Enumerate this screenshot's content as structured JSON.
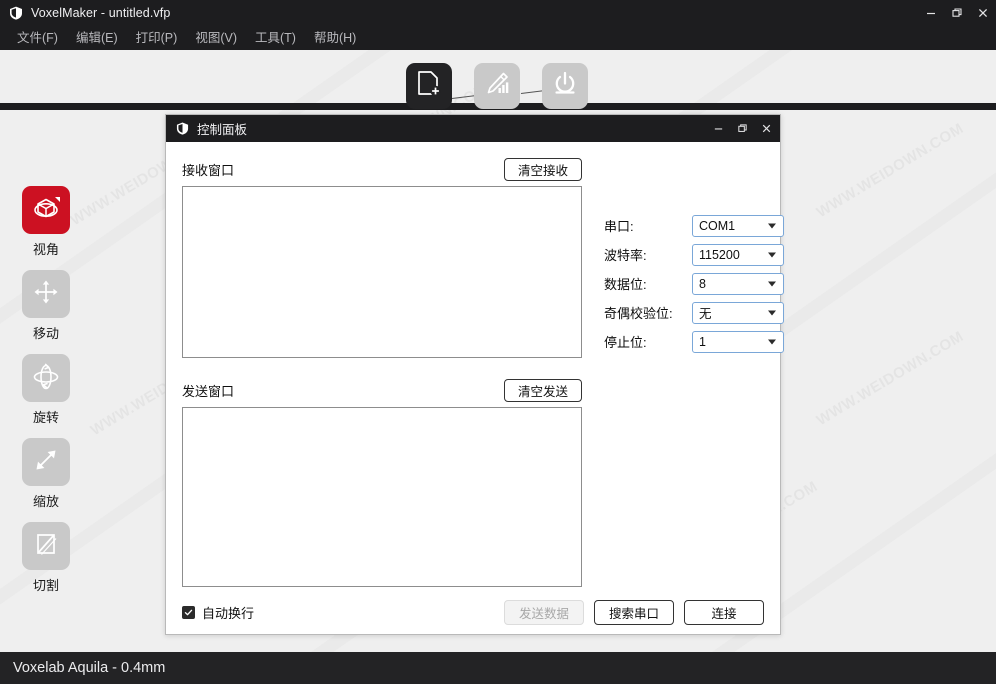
{
  "window": {
    "title": "VoxelMaker - untitled.vfp",
    "logo_icon": "voxelmaker-shield-icon",
    "controls": {
      "minimize": "minimize-icon",
      "restore": "restore-icon",
      "close": "close-icon"
    }
  },
  "menubar": {
    "items": [
      {
        "label": "文件(F)",
        "name": "menu-file"
      },
      {
        "label": "编辑(E)",
        "name": "menu-edit"
      },
      {
        "label": "打印(P)",
        "name": "menu-print"
      },
      {
        "label": "视图(V)",
        "name": "menu-view"
      },
      {
        "label": "工具(T)",
        "name": "menu-tools"
      },
      {
        "label": "帮助(H)",
        "name": "menu-help"
      }
    ]
  },
  "toolbar": {
    "buttons": [
      {
        "icon": "add-file-icon",
        "active": true
      },
      {
        "icon": "edit-chart-icon",
        "active": false
      },
      {
        "icon": "print-power-icon",
        "active": false
      }
    ]
  },
  "sidebar": {
    "items": [
      {
        "label": "视角",
        "icon": "view-cube-icon",
        "active": true
      },
      {
        "label": "移动",
        "icon": "move-arrows-icon",
        "active": false
      },
      {
        "label": "旋转",
        "icon": "rotate-icon",
        "active": false
      },
      {
        "label": "缩放",
        "icon": "scale-diagonal-arrow-icon",
        "active": false
      },
      {
        "label": "切割",
        "icon": "cut-plane-icon",
        "active": false
      }
    ]
  },
  "statusbar": {
    "text": "Voxelab Aquila - 0.4mm"
  },
  "watermark": {
    "text": "WWW.WEIDOWN.COM"
  },
  "dialog": {
    "title": "控制面板",
    "logo_icon": "voxelmaker-shield-icon",
    "controls": {
      "minimize": "minimize-icon",
      "restore": "restore-icon",
      "close": "close-icon"
    },
    "receive": {
      "label": "接收窗口",
      "clear_button": "清空接收",
      "value": ""
    },
    "send": {
      "label": "发送窗口",
      "clear_button": "清空发送",
      "value": ""
    },
    "serial_settings": [
      {
        "label": "串口:",
        "value": "COM1",
        "name": "port-select"
      },
      {
        "label": "波特率:",
        "value": "115200",
        "name": "baudrate-select"
      },
      {
        "label": "数据位:",
        "value": "8",
        "name": "databits-select"
      },
      {
        "label": "奇偶校验位:",
        "value": "无",
        "name": "parity-select"
      },
      {
        "label": "停止位:",
        "value": "1",
        "name": "stopbits-select"
      }
    ],
    "footer": {
      "autowrap_label": "自动换行",
      "autowrap_checked": true,
      "send_button": "发送数据",
      "send_button_disabled": true,
      "search_button": "搜索串口",
      "connect_button": "连接"
    }
  },
  "colors": {
    "chrome": "#1d1d1f",
    "accent_red": "#cc1122",
    "canvas": "#efefef",
    "select_border": "#7aa7d8"
  }
}
